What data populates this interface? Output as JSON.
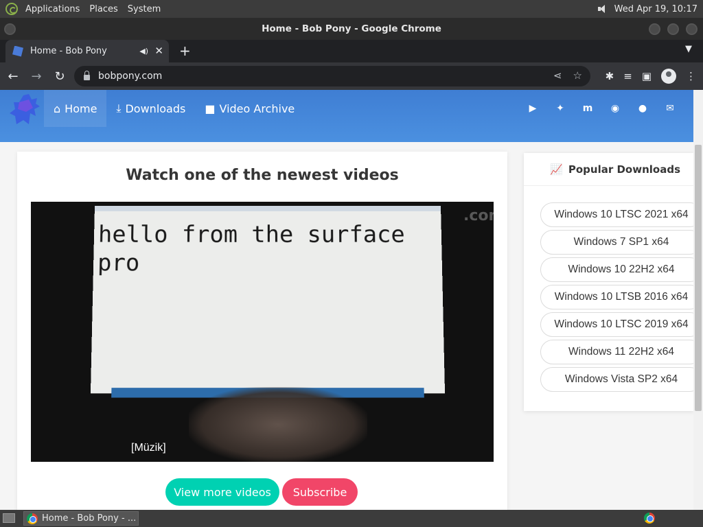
{
  "panel": {
    "menus": [
      "Applications",
      "Places",
      "System"
    ],
    "clock": "Wed Apr 19, 10:17"
  },
  "window": {
    "title": "Home - Bob Pony - Google Chrome"
  },
  "tab": {
    "title": "Home - Bob Pony"
  },
  "omnibox": {
    "url": "bobpony.com"
  },
  "site": {
    "nav": [
      {
        "label": "Home",
        "icon": "home-icon"
      },
      {
        "label": "Downloads",
        "icon": "download-icon"
      },
      {
        "label": "Video Archive",
        "icon": "video-icon"
      }
    ],
    "social": [
      "youtube-icon",
      "twitter-icon",
      "mastodon-icon",
      "discord-icon",
      "github-icon",
      "mail-icon"
    ],
    "main": {
      "title": "Watch one of the newest videos",
      "video_screen_text": "hello from the surface\npro",
      "video_caption": "[Müzik]",
      "btn_more": "View more videos",
      "btn_subscribe": "Subscribe"
    },
    "sidebar": {
      "title": "Popular Downloads",
      "items": [
        "Windows 10 LTSC 2021 x64",
        "Windows 7 SP1 x64",
        "Windows 10 22H2 x64",
        "Windows 10 LTSB 2016 x64",
        "Windows 10 LTSC 2019 x64",
        "Windows 11 22H2 x64",
        "Windows Vista SP2 x64"
      ]
    }
  },
  "taskbar": {
    "task_label": "Home - Bob Pony - ..."
  }
}
